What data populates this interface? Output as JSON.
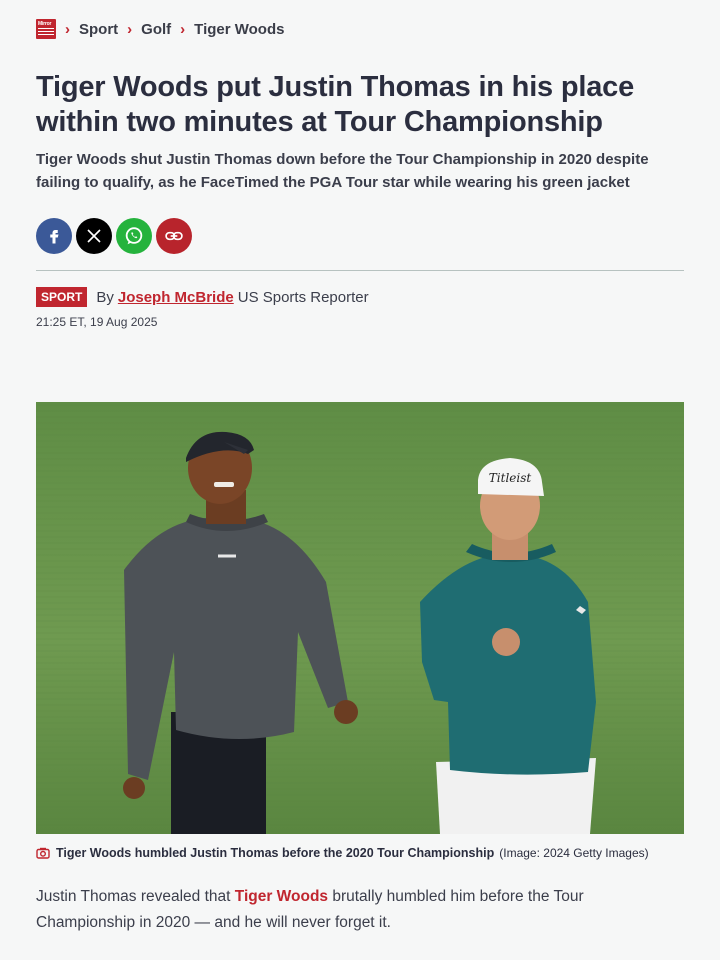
{
  "breadcrumb": {
    "logo_text": "Mirror",
    "items": [
      "Sport",
      "Golf",
      "Tiger Woods"
    ]
  },
  "headline": "Tiger Woods put Justin Thomas in his place within two minutes at Tour Championship",
  "standfirst": "Tiger Woods shut Justin Thomas down before the Tour Championship in 2020 despite failing to qualify, as he FaceTimed the PGA Tour star while wearing his green jacket",
  "share": {
    "icons": [
      "facebook-icon",
      "x-icon",
      "whatsapp-icon",
      "link-icon"
    ]
  },
  "byline": {
    "badge": "SPORT",
    "by": "By",
    "author": "Joseph McBride",
    "role": "US Sports Reporter",
    "timestamp": "21:25 ET, 19 Aug 2025"
  },
  "hero": {
    "caption": "Tiger Woods humbled Justin Thomas before the 2020 Tour Championship",
    "credit": "(Image: 2024 Getty Images)",
    "cap_text_left": "",
    "cap_text_right": "Titleist"
  },
  "article": {
    "intro_before": "Justin Thomas revealed that ",
    "intro_link": "Tiger Woods",
    "intro_after": " brutally humbled him before the Tour Championship in 2020 — and he will never forget it."
  },
  "colors": {
    "brand_red": "#c0262f",
    "text": "#2b2e3f",
    "background": "#f6f7f7",
    "facebook": "#3b5998",
    "whatsapp": "#25b33d"
  }
}
